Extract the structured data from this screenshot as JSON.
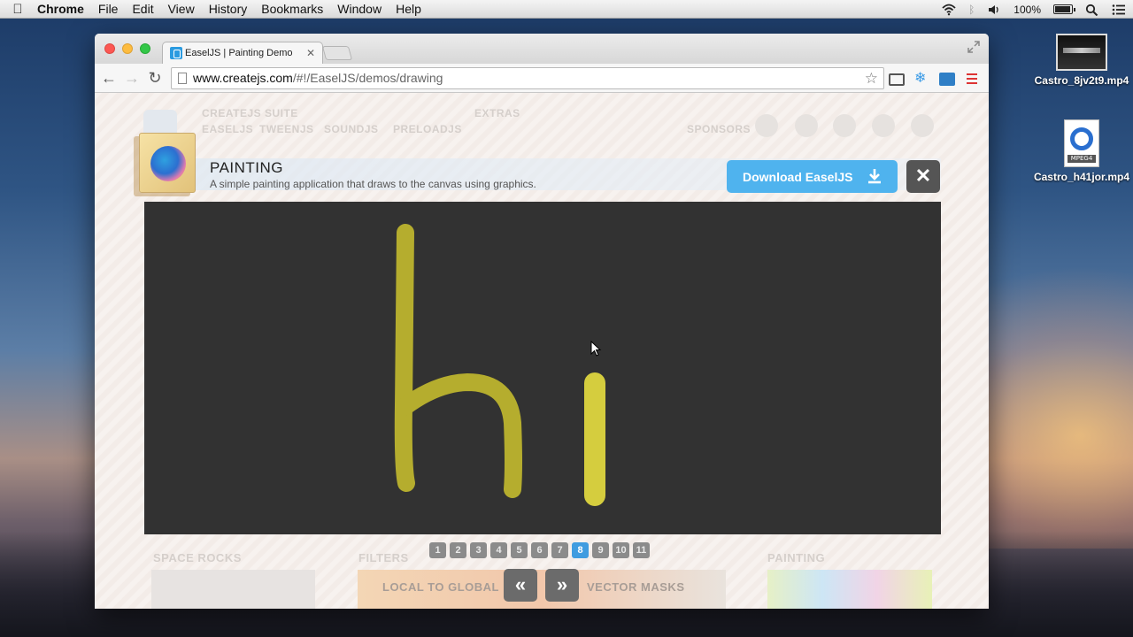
{
  "menubar": {
    "app": "Chrome",
    "items": [
      "File",
      "Edit",
      "View",
      "History",
      "Bookmarks",
      "Window",
      "Help"
    ],
    "battery": "100%",
    "battery_level": 1.0
  },
  "desktop": {
    "icons": [
      {
        "label": "Castro_8jv2t9.mp4",
        "icon": "video-thumbnail-icon"
      },
      {
        "label": "Castro_h41jor.mp4",
        "icon": "quicktime-mpeg4-icon",
        "badge": "MPEG4"
      }
    ]
  },
  "browser": {
    "tab_title": "EaselJS | Painting Demo",
    "url_host": "www.createjs.com",
    "url_path": "/#!/EaselJS/demos/drawing"
  },
  "page": {
    "faded_nav": {
      "suite": "CREATEJS SUITE",
      "easeljs": "EASELJS",
      "tweenjs": "TWEENJS",
      "soundjs": "SOUNDJS",
      "preloadjs": "PRELOADJS",
      "extras": "EXTRAS",
      "sponsors": "SPONSORS"
    },
    "demo": {
      "title": "PAINTING",
      "subtitle": "A simple painting application that draws to the canvas using graphics.",
      "download_label": "Download EaselJS",
      "close_label": "✕",
      "drawn_text": "hi",
      "stroke_color": "#b5ad2e"
    },
    "pagination": {
      "pages": [
        "1",
        "2",
        "3",
        "4",
        "5",
        "6",
        "7",
        "8",
        "9",
        "10",
        "11"
      ],
      "active": "8"
    },
    "carousel": {
      "prev_label": "«",
      "next_label": "»",
      "left_label": "LOCAL TO GLOBAL",
      "right_label": "VECTOR MASKS",
      "cards": [
        "SPACE ROCKS",
        "FILTERS",
        "PAINTING"
      ]
    }
  },
  "colors": {
    "accent": "#4fb3ee",
    "canvas_bg": "#323232",
    "pager_active": "#3f9ce0"
  }
}
